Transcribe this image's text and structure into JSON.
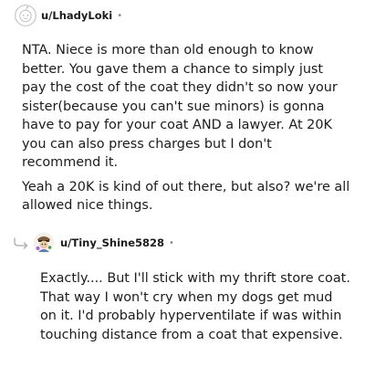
{
  "comments": [
    {
      "username": "u/LhadyLoki",
      "separator": "•",
      "avatar_icon": "default-avatar-icon",
      "paragraphs": [
        "NTA. Niece is more than old enough to know better. You gave them a chance to simply just pay the cost of the coat they didn't so now your sister(because you can't sue minors) is gonna have to pay for your coat AND a lawyer. At 20K you can also press charges but I don't recommend it.",
        "Yeah a 20K is kind of out there, but also? we're all allowed nice things."
      ]
    },
    {
      "username": "u/Tiny_Shine5828",
      "separator": "•",
      "avatar_icon": "custom-avatar-icon",
      "reply_icon": "reply-arrow-icon",
      "paragraphs": [
        "Exactly.... But I'll stick with my thrift store coat. That way I won't cry when my dogs get mud on it. I'd probably hyperventilate if was within touching distance from a coat that expensive."
      ]
    }
  ],
  "colors": {
    "text": "#1c1c1c",
    "muted": "#878a8c",
    "background": "#ffffff"
  }
}
